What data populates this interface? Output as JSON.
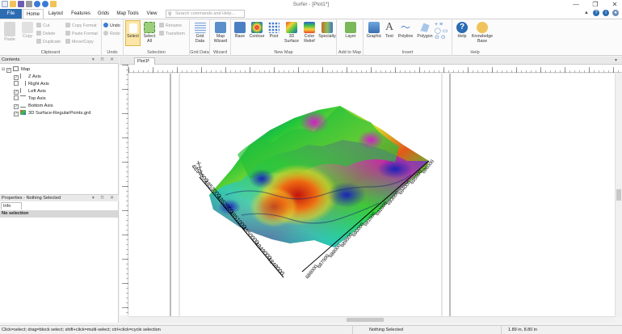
{
  "app": {
    "title": "Surfer - [Plot1*]"
  },
  "window_controls": [
    "—",
    "❐",
    "✕"
  ],
  "tabs": [
    {
      "label": "File"
    },
    {
      "label": "Home"
    },
    {
      "label": "Layout"
    },
    {
      "label": "Features"
    },
    {
      "label": "Grids"
    },
    {
      "label": "Map Tools"
    },
    {
      "label": "View"
    }
  ],
  "search": {
    "placeholder": "Search commands and Help..."
  },
  "ribbon": {
    "clipboard": {
      "label": "Clipboard",
      "paste": "Paste",
      "copy": "Copy",
      "cut": "Cut",
      "delete": "Delete",
      "duplicate": "Duplicate",
      "copy_format": "Copy Format",
      "paste_format": "Paste Format",
      "move_copy": "Move/Copy"
    },
    "undo": {
      "label": "Undo",
      "undo": "Undo",
      "redo": "Redo"
    },
    "selection": {
      "label": "Selection",
      "select": "Select",
      "select_all": "Select All",
      "rename": "Rename",
      "transform": "Transform"
    },
    "grid_data": {
      "label": "Grid Data",
      "button": "Grid Data"
    },
    "wizard": {
      "label": "Wizard",
      "button": "Map Wizard"
    },
    "new_map": {
      "label": "New Map",
      "base": "Base",
      "contour": "Contour",
      "post": "Post",
      "surface_3d": "3D Surface",
      "color_relief": "Color Relief",
      "specialty": "Specialty"
    },
    "add_to_map": {
      "label": "Add to Map",
      "layer": "Layer"
    },
    "insert": {
      "label": "Insert",
      "graphic": "Graphic",
      "text": "Text",
      "polyline": "Polyline",
      "polygon": "Polygon"
    },
    "help": {
      "label": "Help",
      "help": "Help",
      "knowledge_base": "Knowledge Base"
    }
  },
  "contents": {
    "title": "Contents",
    "tree": [
      {
        "label": "Map",
        "checked": true
      },
      {
        "label": "Z Axis",
        "checked": true
      },
      {
        "label": "Right Axis",
        "checked": false
      },
      {
        "label": "Left Axis",
        "checked": true
      },
      {
        "label": "Top Axis",
        "checked": false
      },
      {
        "label": "Bottom Axis",
        "checked": true
      },
      {
        "label": "3D Surface-RegularPoints.grd",
        "checked": true
      }
    ]
  },
  "properties": {
    "title": "Properties - Nothing Selected",
    "tab": "Info",
    "status": "No selection"
  },
  "document": {
    "tab": "Plot1*"
  },
  "plot": {
    "y_axis_ticks": [
      "4848000",
      "4849000",
      "4850000",
      "4851000",
      "4852000",
      "4853000",
      "4854000"
    ],
    "x_axis_ticks": [
      "686000",
      "687000",
      "688000",
      "689000",
      "690000",
      "691000",
      "692000",
      "693000",
      "694000",
      "695000",
      "696000"
    ]
  },
  "status": {
    "hint": "Click=select; drag=block select; shift+click=multi-select; ctrl+click=cycle selection",
    "selection": "Nothing Selected",
    "coords": "1.89 in, 8.80 in"
  }
}
